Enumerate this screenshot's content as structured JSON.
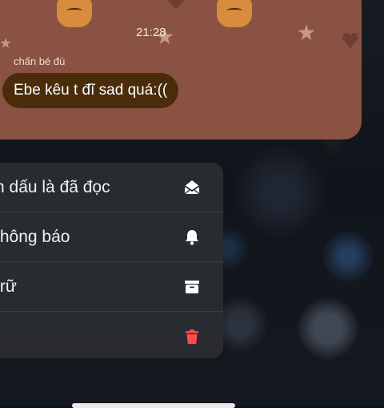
{
  "chat_preview": {
    "time": "21:28",
    "sender": "chấn bé đù",
    "message": "Ebe kêu t đĩ sad quá:(("
  },
  "context_menu": {
    "items": [
      {
        "label": "h dấu là đã đọc",
        "icon": "envelope-open-icon",
        "color": "#ffffff"
      },
      {
        "label": "thông báo",
        "icon": "bell-icon",
        "color": "#ffffff"
      },
      {
        "label": "trữ",
        "icon": "archive-icon",
        "color": "#ffffff"
      },
      {
        "label": "",
        "icon": "trash-icon",
        "color": "#ff4b4b"
      }
    ]
  },
  "colors": {
    "preview_bg": "#8a5242",
    "bubble_bg": "#4a2c0b",
    "menu_bg": "#2a2c32",
    "destructive": "#ff4b4b"
  }
}
